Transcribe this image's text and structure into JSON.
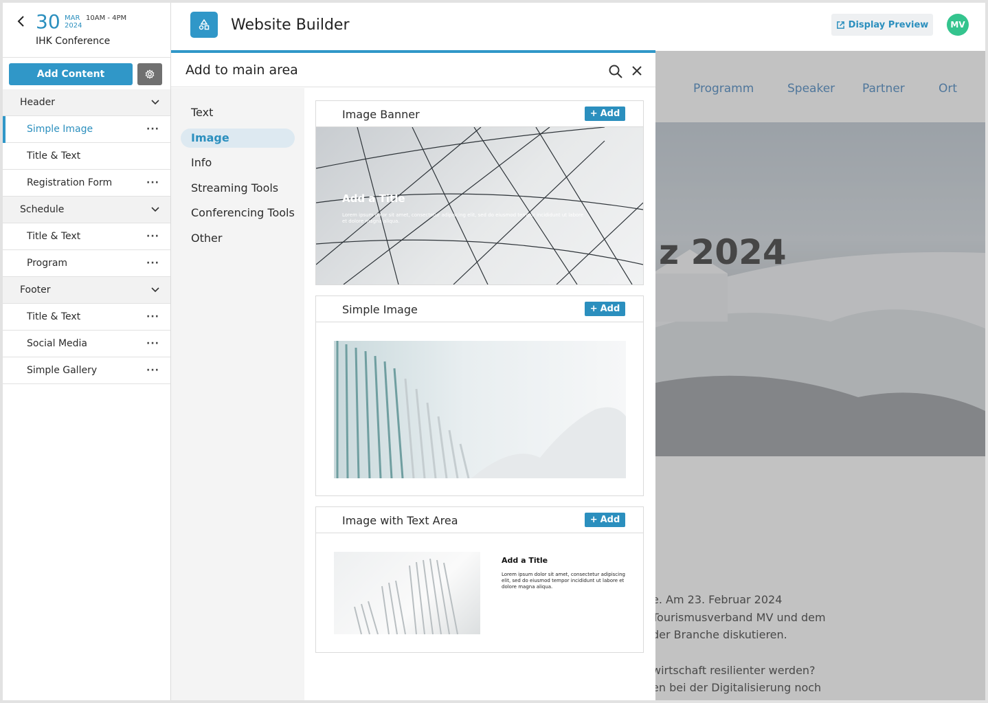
{
  "event": {
    "day": "30",
    "month": "MAR",
    "year": "2024",
    "time": "10AM - 4PM",
    "name": "IHK Conference"
  },
  "sidebar": {
    "add_content_label": "Add Content",
    "sections": [
      {
        "label": "Header",
        "items": [
          "Simple Image",
          "Title & Text",
          "Registration Form"
        ]
      },
      {
        "label": "Schedule",
        "items": [
          "Title & Text",
          "Program"
        ]
      },
      {
        "label": "Footer",
        "items": [
          "Title & Text",
          "Social Media",
          "Simple Gallery"
        ]
      }
    ],
    "active_item": "Simple Image"
  },
  "topbar": {
    "title": "Website Builder",
    "preview_label": "Display Preview",
    "avatar_initials": "MV"
  },
  "panel": {
    "title": "Add to main area",
    "categories": [
      "Text",
      "Image",
      "Info",
      "Streaming Tools",
      "Conferencing Tools",
      "Other"
    ],
    "active_category": "Image",
    "add_label": "Add",
    "cards": [
      {
        "title": "Image Banner",
        "preview_title": "Add a Title",
        "preview_text": "Lorem ipsum dolor sit amet, consectetur adipiscing elit, sed do eiusmod tempor incididunt ut labore et dolore magna aliqua."
      },
      {
        "title": "Simple Image"
      },
      {
        "title": "Image with Text Area",
        "preview_title": "Add a Title",
        "preview_text": "Lorem ipsum dolor sit amet, consectetur adipiscing elit, sed do eiusmod tempor incididunt ut labore et dolore magna aliqua."
      }
    ]
  },
  "site": {
    "nav": [
      "Programm",
      "Speaker",
      "Partner",
      "Ort"
    ],
    "hero_title_visible": "z 2024",
    "text_lines": [
      "e. Am 23. Februar 2024",
      "Tourismusverband MV und dem",
      "der Branche diskutieren.",
      "wirtschaft resilienter werden?",
      "en bei der Digitalisierung noch"
    ]
  },
  "colors": {
    "accent": "#3097c8",
    "link": "#2b8fbe",
    "avatar": "#34c48e"
  }
}
